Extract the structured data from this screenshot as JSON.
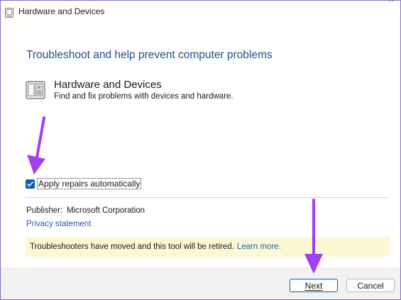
{
  "window": {
    "title": "Hardware and Devices",
    "close_hint": "^"
  },
  "main": {
    "heading": "Troubleshoot and help prevent computer problems",
    "tool": {
      "name": "Hardware and Devices",
      "description": "Find and fix problems with devices and hardware.",
      "icon": "hardware-device-icon"
    },
    "apply_repairs": {
      "label": "Apply repairs automatically",
      "checked": true
    },
    "publisher": {
      "label": "Publisher:",
      "value": "Microsoft Corporation"
    },
    "privacy_link": "Privacy statement",
    "notice": {
      "text": "Troubleshooters have moved and this tool will be retired.",
      "link": "Learn more."
    }
  },
  "footer": {
    "next_label": "Next",
    "cancel_label": "Cancel"
  },
  "colors": {
    "accent": "#0a5fb4",
    "heading": "#1f4e8c",
    "link": "#1f5fa8",
    "notice_bg": "#fcf8d4",
    "annotation_arrow": "#a23ff0"
  }
}
